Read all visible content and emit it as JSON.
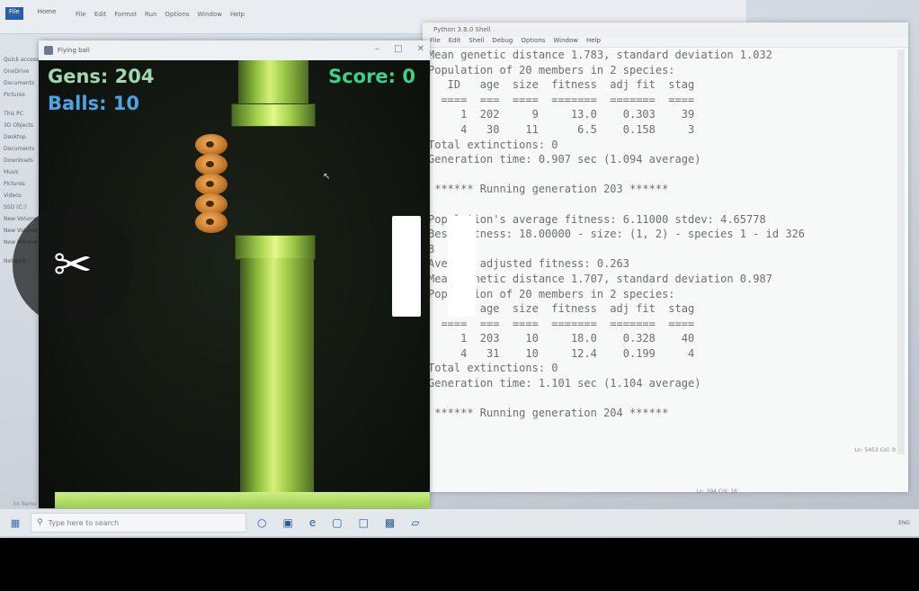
{
  "explorer": {
    "ribbon_tabs": [
      "File",
      "Home"
    ],
    "menu": [
      "File",
      "Edit",
      "Format",
      "Run",
      "Options",
      "Window",
      "Help"
    ],
    "sidebar": [
      "Quick access",
      "OneDrive",
      "Documents",
      "Pictures",
      "This PC",
      "3D Objects",
      "Desktop",
      "Documents",
      "Downloads",
      "Music",
      "Pictures",
      "Videos",
      "SSD (C:)",
      "New Volume",
      "New Volume",
      "New Volume",
      "Network"
    ],
    "item_count": "34 items"
  },
  "game": {
    "window_title": "Flying ball",
    "gens_label": "Gens: 204",
    "balls_label": "Balls: 10",
    "score_label": "Score: 0",
    "colors": {
      "gens": "#9fd8b0",
      "balls": "#4fa3e3",
      "score": "#3fd08a",
      "pipe": "#9cc946"
    }
  },
  "shell": {
    "window_title": "Python 3.8.0 Shell",
    "menu": [
      "File",
      "Edit",
      "Shell",
      "Debug",
      "Options",
      "Window",
      "Help"
    ],
    "output_lines": [
      "Mean genetic distance 1.783, standard deviation 1.032",
      "Population of 20 members in 2 species:",
      "   ID   age  size  fitness  adj fit  stag",
      "  ====  ===  ====  =======  =======  ====",
      "     1  202     9     13.0    0.303    39",
      "     4   30    11      6.5    0.158     3",
      "Total extinctions: 0",
      "Generation time: 0.907 sec (1.094 average)",
      "",
      " ****** Running generation 203 ******",
      "",
      "Population's average fitness: 6.11000 stdev: 4.65778",
      "Best fitness: 18.00000 - size: (1, 2) - species 1 - id 326",
      "8",
      "Average adjusted fitness: 0.263",
      "Mean genetic distance 1.707, standard deviation 0.987",
      "Population of 20 members in 2 species:",
      "   ID   age  size  fitness  adj fit  stag",
      "  ====  ===  ====  =======  =======  ====",
      "     1  203    10     18.0    0.328    40",
      "     4   31    10     12.4    0.199     4",
      "Total extinctions: 0",
      "Generation time: 1.101 sec (1.104 average)",
      "",
      " ****** Running generation 204 ******"
    ],
    "status": "Ln: 5453  Col: 0",
    "status2": "Ln: 394  Col: 16"
  },
  "taskbar": {
    "search_placeholder": "Type here to search",
    "tray_text": "ENG"
  },
  "overlay": {
    "scissors_icon": "scissors-icon",
    "pause_icon": "pause-icon"
  }
}
